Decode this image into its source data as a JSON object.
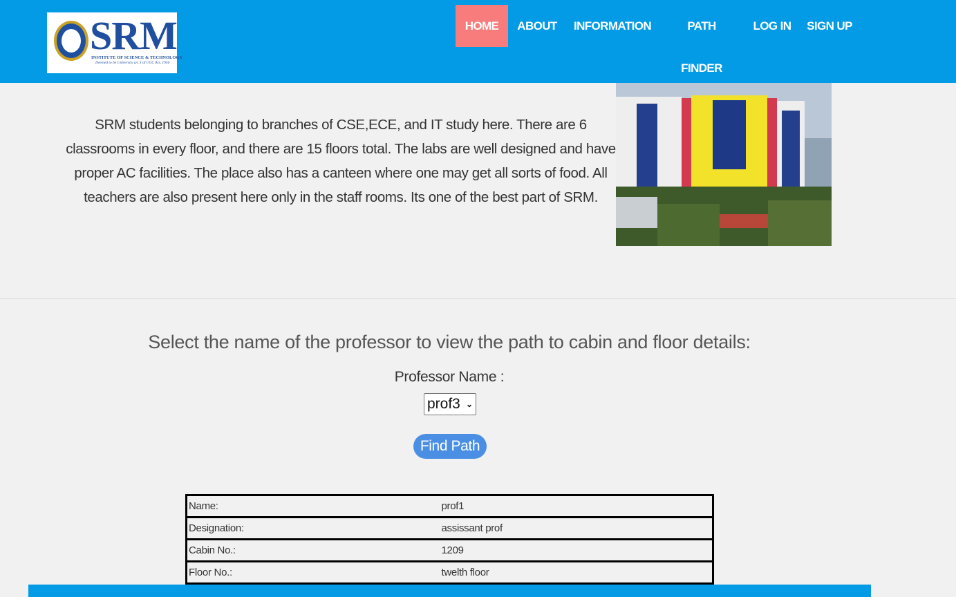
{
  "logo": {
    "wordmark": "SRM",
    "line1": "INSTITUTE OF SCIENCE & TECHNOLOGY",
    "line2": "Deemed to be University u/s 3 of UGC Act, 1956"
  },
  "nav": {
    "items": [
      {
        "label": "HOME",
        "active": true
      },
      {
        "label": "ABOUT"
      },
      {
        "label": "INFORMATION"
      },
      {
        "label": "PATH FINDER"
      },
      {
        "label": "LOG IN"
      },
      {
        "label": "SIGN UP"
      }
    ]
  },
  "about": {
    "text": "SRM students belonging to branches of CSE,ECE, and IT study here. There are 6 classrooms in every floor, and there are 15 floors total. The labs are well designed and have proper AC facilities. The place also has a canteen where one may get all sorts of food. All teachers are also present here only in the staff rooms. Its one of the best part of SRM."
  },
  "finder": {
    "prompt": "Select the name of the professor to view the path to cabin and floor details:",
    "label": "Professor Name :",
    "selected": "prof3",
    "button": "Find Path"
  },
  "details": {
    "rows": [
      {
        "label": "Name:",
        "value": "prof1"
      },
      {
        "label": "Designation:",
        "value": "assissant prof"
      },
      {
        "label": "Cabin No.:",
        "value": "1209"
      },
      {
        "label": "Floor No.:",
        "value": "twelth floor"
      }
    ]
  },
  "colors": {
    "header": "#039be5",
    "active_nav": "#f87c7c",
    "button": "#4a8fe3"
  }
}
